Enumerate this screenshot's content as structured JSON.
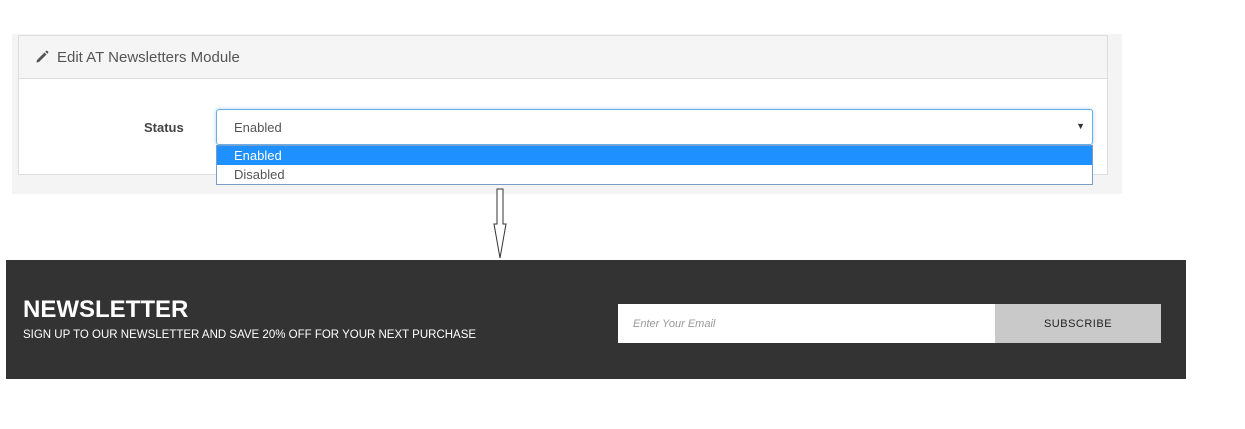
{
  "admin": {
    "panel_title": "Edit AT Newsletters Module",
    "title_icon": "pencil-icon",
    "status_label": "Status",
    "status_select": {
      "selected": "Enabled",
      "options": [
        "Enabled",
        "Disabled"
      ],
      "highlighted_option": "Enabled"
    }
  },
  "newsletter": {
    "title": "NEWSLETTER",
    "subtitle": "SIGN UP TO OUR NEWSLETTER AND SAVE 20% OFF FOR YOUR NEXT PURCHASE",
    "email_placeholder": "Enter Your Email",
    "subscribe_label": "SUBSCRIBE"
  },
  "colors": {
    "newsletter_bg": "#333333",
    "subscribe_bg": "#c9c9c9",
    "option_highlight": "#1e90ff",
    "select_focus_border": "#66afe9"
  }
}
